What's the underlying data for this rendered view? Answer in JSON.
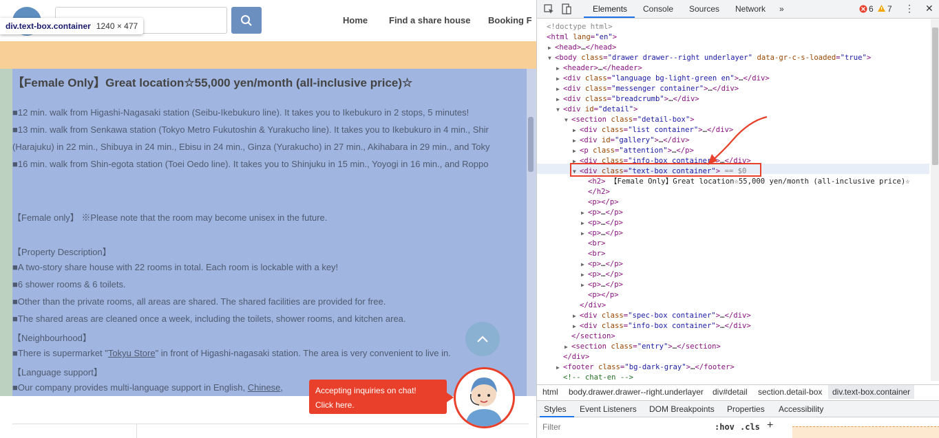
{
  "page": {
    "tooltip": {
      "selector": "div.text-box.container",
      "size": "1240 × 477"
    },
    "nav": [
      "Home",
      "Find a share house",
      "Booking F"
    ],
    "content": {
      "title": "【Female Only】Great location☆55,000 yen/month (all-inclusive price)☆",
      "lines": [
        "■12 min. walk from Higashi-Nagasaki station (Seibu-Ikebukuro line). It takes you to Ikebukuro in 2 stops, 5 minutes!",
        "■13 min. walk from Senkawa station (Tokyo Metro Fukutoshin & Yurakucho line). It takes you to Ikebukuro in 4 min., Shir",
        "(Harajuku) in 22 min., Shibuya in 24 min., Ebisu in 24 min., Ginza (Yurakucho) in 27 min., Akihabara in 29 min., and Toky",
        "■16 min. walk from Shin-egota station (Toei Oedo line). It takes you to Shinjuku in 15 min., Yoyogi in 16 min., and Roppo",
        "【Female only】 ※Please note that the room may become unisex in the future.",
        "【Property Description】",
        "■A two-story share house with 22 rooms in total. Each room is lockable with a key!",
        "■6 shower rooms & 6 toilets.",
        "■Other than the private rooms, all areas are shared. The shared facilities are provided for free.",
        "■The shared areas are cleaned once a week, including the toilets, shower rooms, and kitchen area.",
        "【Neighbourhood】",
        "【Language support】"
      ],
      "supermarket_pre": "■There is supermarket \"",
      "supermarket_link": "Tokyu Store",
      "supermarket_post": "\" in front of Higashi-nagasaki station. The area is very convenient to live in.",
      "lang_pre": "■Our company provides multi-language support in English, ",
      "lang_link1": "Chinese",
      "lang_post": ", "
    },
    "chat": {
      "line1": "Accepting inquiries on chat!",
      "line2": "Click here."
    }
  },
  "devtools": {
    "tabs": [
      "Elements",
      "Console",
      "Sources",
      "Network",
      "»"
    ],
    "errors": "6",
    "warnings": "7",
    "tree": [
      {
        "indent": 0,
        "parts": [
          [
            "gr",
            "<!doctype html>"
          ]
        ]
      },
      {
        "indent": 0,
        "parts": [
          [
            "tg",
            "<html "
          ],
          [
            "an",
            "lang"
          ],
          [
            "tg",
            "="
          ],
          [
            "av2",
            "\"en\""
          ],
          [
            "tg",
            ">"
          ]
        ]
      },
      {
        "indent": 1,
        "arrow": "▶",
        "parts": [
          [
            "tg",
            "<head>"
          ],
          [
            "tx",
            "…"
          ],
          [
            "tg",
            "</head>"
          ]
        ]
      },
      {
        "indent": 1,
        "arrow": "▼",
        "parts": [
          [
            "tg",
            "<body "
          ],
          [
            "an",
            "class"
          ],
          [
            "tg",
            "="
          ],
          [
            "av2",
            "\"drawer drawer--right underlayer\""
          ],
          [
            "tg",
            " "
          ],
          [
            "an",
            "data-gr-c-s-loaded"
          ],
          [
            "tg",
            "="
          ],
          [
            "av2",
            "\"true\""
          ],
          [
            "tg",
            ">"
          ]
        ]
      },
      {
        "indent": 2,
        "arrow": "▶",
        "parts": [
          [
            "tg",
            "<header>"
          ],
          [
            "tx",
            "…"
          ],
          [
            "tg",
            "</header>"
          ]
        ]
      },
      {
        "indent": 2,
        "arrow": "▶",
        "parts": [
          [
            "tg",
            "<div "
          ],
          [
            "an",
            "class"
          ],
          [
            "tg",
            "="
          ],
          [
            "av2",
            "\"language bg-light-green en\""
          ],
          [
            "tg",
            ">"
          ],
          [
            "tx",
            "…"
          ],
          [
            "tg",
            "</div>"
          ]
        ]
      },
      {
        "indent": 2,
        "arrow": "▶",
        "parts": [
          [
            "tg",
            "<div "
          ],
          [
            "an",
            "class"
          ],
          [
            "tg",
            "="
          ],
          [
            "av2",
            "\"messenger container\""
          ],
          [
            "tg",
            ">"
          ],
          [
            "tx",
            "…"
          ],
          [
            "tg",
            "</div>"
          ]
        ]
      },
      {
        "indent": 2,
        "arrow": "▶",
        "parts": [
          [
            "tg",
            "<div "
          ],
          [
            "an",
            "class"
          ],
          [
            "tg",
            "="
          ],
          [
            "av2",
            "\"breadcrumb\""
          ],
          [
            "tg",
            ">"
          ],
          [
            "tx",
            "…"
          ],
          [
            "tg",
            "</div>"
          ]
        ]
      },
      {
        "indent": 2,
        "arrow": "▼",
        "parts": [
          [
            "tg",
            "<div "
          ],
          [
            "an",
            "id"
          ],
          [
            "tg",
            "="
          ],
          [
            "av2",
            "\"detail\""
          ],
          [
            "tg",
            ">"
          ]
        ]
      },
      {
        "indent": 3,
        "arrow": "▼",
        "parts": [
          [
            "tg",
            "<section "
          ],
          [
            "an",
            "class"
          ],
          [
            "tg",
            "="
          ],
          [
            "av2",
            "\"detail-box\""
          ],
          [
            "tg",
            ">"
          ]
        ]
      },
      {
        "indent": 4,
        "arrow": "▶",
        "parts": [
          [
            "tg",
            "<div "
          ],
          [
            "an",
            "class"
          ],
          [
            "tg",
            "="
          ],
          [
            "av2",
            "\"list container\""
          ],
          [
            "tg",
            ">"
          ],
          [
            "tx",
            "…"
          ],
          [
            "tg",
            "</div>"
          ]
        ]
      },
      {
        "indent": 4,
        "arrow": "▶",
        "parts": [
          [
            "tg",
            "<div "
          ],
          [
            "an",
            "id"
          ],
          [
            "tg",
            "="
          ],
          [
            "av2",
            "\"gallery\""
          ],
          [
            "tg",
            ">"
          ],
          [
            "tx",
            "…"
          ],
          [
            "tg",
            "</div>"
          ]
        ]
      },
      {
        "indent": 4,
        "arrow": "▶",
        "parts": [
          [
            "tg",
            "<p "
          ],
          [
            "an",
            "class"
          ],
          [
            "tg",
            "="
          ],
          [
            "av2",
            "\"attention\""
          ],
          [
            "tg",
            ">"
          ],
          [
            "tx",
            "…"
          ],
          [
            "tg",
            "</p>"
          ]
        ]
      },
      {
        "indent": 4,
        "arrow": "▶",
        "parts": [
          [
            "tg",
            "<div "
          ],
          [
            "an",
            "class"
          ],
          [
            "tg",
            "="
          ],
          [
            "av2",
            "\"info-box container\""
          ],
          [
            "tg",
            ">"
          ],
          [
            "tx",
            "…"
          ],
          [
            "tg",
            "</div>"
          ]
        ]
      },
      {
        "indent": 4,
        "arrow": "▼",
        "parts": [
          [
            "tg",
            "<div "
          ],
          [
            "an",
            "class"
          ],
          [
            "tg",
            "="
          ],
          [
            "av2",
            "\"text-box container\""
          ],
          [
            "tg",
            ">"
          ],
          [
            "gr",
            " == $0"
          ]
        ]
      },
      {
        "indent": 5,
        "parts": [
          [
            "tg",
            "<h2>"
          ],
          [
            "tx",
            " 【Female Only】Great location☆55,000 yen/month (all-inclusive price)☆"
          ]
        ]
      },
      {
        "indent": 5,
        "parts": [
          [
            "tg",
            "</h2>"
          ]
        ]
      },
      {
        "indent": 5,
        "parts": [
          [
            "tg",
            "<p></p>"
          ]
        ]
      },
      {
        "indent": 5,
        "arrow": "▶",
        "parts": [
          [
            "tg",
            "<p>"
          ],
          [
            "tx",
            "…"
          ],
          [
            "tg",
            "</p>"
          ]
        ]
      },
      {
        "indent": 5,
        "arrow": "▶",
        "parts": [
          [
            "tg",
            "<p>"
          ],
          [
            "tx",
            "…"
          ],
          [
            "tg",
            "</p>"
          ]
        ]
      },
      {
        "indent": 5,
        "arrow": "▶",
        "parts": [
          [
            "tg",
            "<p>"
          ],
          [
            "tx",
            "…"
          ],
          [
            "tg",
            "</p>"
          ]
        ]
      },
      {
        "indent": 5,
        "parts": [
          [
            "tg",
            "<br>"
          ]
        ]
      },
      {
        "indent": 5,
        "parts": [
          [
            "tg",
            "<br>"
          ]
        ]
      },
      {
        "indent": 5,
        "arrow": "▶",
        "parts": [
          [
            "tg",
            "<p>"
          ],
          [
            "tx",
            "…"
          ],
          [
            "tg",
            "</p>"
          ]
        ]
      },
      {
        "indent": 5,
        "arrow": "▶",
        "parts": [
          [
            "tg",
            "<p>"
          ],
          [
            "tx",
            "…"
          ],
          [
            "tg",
            "</p>"
          ]
        ]
      },
      {
        "indent": 5,
        "arrow": "▶",
        "parts": [
          [
            "tg",
            "<p>"
          ],
          [
            "tx",
            "…"
          ],
          [
            "tg",
            "</p>"
          ]
        ]
      },
      {
        "indent": 5,
        "parts": [
          [
            "tg",
            "<p></p>"
          ]
        ]
      },
      {
        "indent": 4,
        "parts": [
          [
            "tg",
            "</div>"
          ]
        ]
      },
      {
        "indent": 4,
        "arrow": "▶",
        "parts": [
          [
            "tg",
            "<div "
          ],
          [
            "an",
            "class"
          ],
          [
            "tg",
            "="
          ],
          [
            "av2",
            "\"spec-box container\""
          ],
          [
            "tg",
            ">"
          ],
          [
            "tx",
            "…"
          ],
          [
            "tg",
            "</div>"
          ]
        ]
      },
      {
        "indent": 4,
        "arrow": "▶",
        "parts": [
          [
            "tg",
            "<div "
          ],
          [
            "an",
            "class"
          ],
          [
            "tg",
            "="
          ],
          [
            "av2",
            "\"info-box container\""
          ],
          [
            "tg",
            ">"
          ],
          [
            "tx",
            "…"
          ],
          [
            "tg",
            "</div>"
          ]
        ]
      },
      {
        "indent": 3,
        "parts": [
          [
            "tg",
            "</section>"
          ]
        ]
      },
      {
        "indent": 3,
        "arrow": "▶",
        "parts": [
          [
            "tg",
            "<section "
          ],
          [
            "an",
            "class"
          ],
          [
            "tg",
            "="
          ],
          [
            "av2",
            "\"entry\""
          ],
          [
            "tg",
            ">"
          ],
          [
            "tx",
            "…"
          ],
          [
            "tg",
            "</section>"
          ]
        ]
      },
      {
        "indent": 2,
        "parts": [
          [
            "tg",
            "</div>"
          ]
        ]
      },
      {
        "indent": 2,
        "arrow": "▶",
        "parts": [
          [
            "tg",
            "<footer "
          ],
          [
            "an",
            "class"
          ],
          [
            "tg",
            "="
          ],
          [
            "av2",
            "\"bg-dark-gray\""
          ],
          [
            "tg",
            ">"
          ],
          [
            "tx",
            "…"
          ],
          [
            "tg",
            "</footer>"
          ]
        ]
      },
      {
        "indent": 2,
        "parts": [
          [
            "cm",
            "<!-- chat-en -->"
          ]
        ]
      }
    ],
    "crumbs": [
      "html",
      "body.drawer.drawer--right.underlayer",
      "div#detail",
      "section.detail-box",
      "div.text-box.container"
    ],
    "subtabs": [
      "Styles",
      "Event Listeners",
      "DOM Breakpoints",
      "Properties",
      "Accessibility"
    ],
    "filter": {
      "placeholder": "Filter",
      "hov": ":hov",
      "cls": ".cls",
      "plus": "+"
    }
  }
}
